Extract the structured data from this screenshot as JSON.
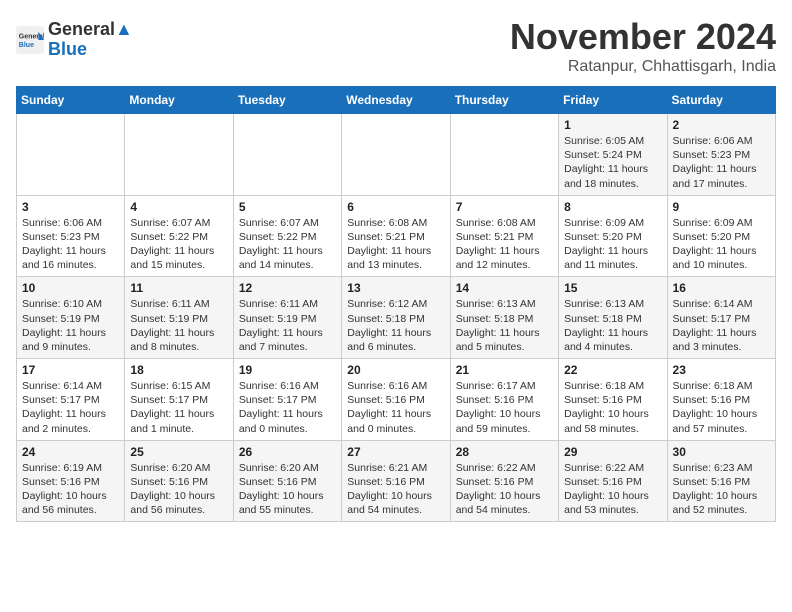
{
  "header": {
    "logo_line1": "General",
    "logo_line2": "Blue",
    "month": "November 2024",
    "location": "Ratanpur, Chhattisgarh, India"
  },
  "days_of_week": [
    "Sunday",
    "Monday",
    "Tuesday",
    "Wednesday",
    "Thursday",
    "Friday",
    "Saturday"
  ],
  "weeks": [
    [
      {
        "num": "",
        "info": ""
      },
      {
        "num": "",
        "info": ""
      },
      {
        "num": "",
        "info": ""
      },
      {
        "num": "",
        "info": ""
      },
      {
        "num": "",
        "info": ""
      },
      {
        "num": "1",
        "info": "Sunrise: 6:05 AM\nSunset: 5:24 PM\nDaylight: 11 hours and 18 minutes."
      },
      {
        "num": "2",
        "info": "Sunrise: 6:06 AM\nSunset: 5:23 PM\nDaylight: 11 hours and 17 minutes."
      }
    ],
    [
      {
        "num": "3",
        "info": "Sunrise: 6:06 AM\nSunset: 5:23 PM\nDaylight: 11 hours and 16 minutes."
      },
      {
        "num": "4",
        "info": "Sunrise: 6:07 AM\nSunset: 5:22 PM\nDaylight: 11 hours and 15 minutes."
      },
      {
        "num": "5",
        "info": "Sunrise: 6:07 AM\nSunset: 5:22 PM\nDaylight: 11 hours and 14 minutes."
      },
      {
        "num": "6",
        "info": "Sunrise: 6:08 AM\nSunset: 5:21 PM\nDaylight: 11 hours and 13 minutes."
      },
      {
        "num": "7",
        "info": "Sunrise: 6:08 AM\nSunset: 5:21 PM\nDaylight: 11 hours and 12 minutes."
      },
      {
        "num": "8",
        "info": "Sunrise: 6:09 AM\nSunset: 5:20 PM\nDaylight: 11 hours and 11 minutes."
      },
      {
        "num": "9",
        "info": "Sunrise: 6:09 AM\nSunset: 5:20 PM\nDaylight: 11 hours and 10 minutes."
      }
    ],
    [
      {
        "num": "10",
        "info": "Sunrise: 6:10 AM\nSunset: 5:19 PM\nDaylight: 11 hours and 9 minutes."
      },
      {
        "num": "11",
        "info": "Sunrise: 6:11 AM\nSunset: 5:19 PM\nDaylight: 11 hours and 8 minutes."
      },
      {
        "num": "12",
        "info": "Sunrise: 6:11 AM\nSunset: 5:19 PM\nDaylight: 11 hours and 7 minutes."
      },
      {
        "num": "13",
        "info": "Sunrise: 6:12 AM\nSunset: 5:18 PM\nDaylight: 11 hours and 6 minutes."
      },
      {
        "num": "14",
        "info": "Sunrise: 6:13 AM\nSunset: 5:18 PM\nDaylight: 11 hours and 5 minutes."
      },
      {
        "num": "15",
        "info": "Sunrise: 6:13 AM\nSunset: 5:18 PM\nDaylight: 11 hours and 4 minutes."
      },
      {
        "num": "16",
        "info": "Sunrise: 6:14 AM\nSunset: 5:17 PM\nDaylight: 11 hours and 3 minutes."
      }
    ],
    [
      {
        "num": "17",
        "info": "Sunrise: 6:14 AM\nSunset: 5:17 PM\nDaylight: 11 hours and 2 minutes."
      },
      {
        "num": "18",
        "info": "Sunrise: 6:15 AM\nSunset: 5:17 PM\nDaylight: 11 hours and 1 minute."
      },
      {
        "num": "19",
        "info": "Sunrise: 6:16 AM\nSunset: 5:17 PM\nDaylight: 11 hours and 0 minutes."
      },
      {
        "num": "20",
        "info": "Sunrise: 6:16 AM\nSunset: 5:16 PM\nDaylight: 11 hours and 0 minutes."
      },
      {
        "num": "21",
        "info": "Sunrise: 6:17 AM\nSunset: 5:16 PM\nDaylight: 10 hours and 59 minutes."
      },
      {
        "num": "22",
        "info": "Sunrise: 6:18 AM\nSunset: 5:16 PM\nDaylight: 10 hours and 58 minutes."
      },
      {
        "num": "23",
        "info": "Sunrise: 6:18 AM\nSunset: 5:16 PM\nDaylight: 10 hours and 57 minutes."
      }
    ],
    [
      {
        "num": "24",
        "info": "Sunrise: 6:19 AM\nSunset: 5:16 PM\nDaylight: 10 hours and 56 minutes."
      },
      {
        "num": "25",
        "info": "Sunrise: 6:20 AM\nSunset: 5:16 PM\nDaylight: 10 hours and 56 minutes."
      },
      {
        "num": "26",
        "info": "Sunrise: 6:20 AM\nSunset: 5:16 PM\nDaylight: 10 hours and 55 minutes."
      },
      {
        "num": "27",
        "info": "Sunrise: 6:21 AM\nSunset: 5:16 PM\nDaylight: 10 hours and 54 minutes."
      },
      {
        "num": "28",
        "info": "Sunrise: 6:22 AM\nSunset: 5:16 PM\nDaylight: 10 hours and 54 minutes."
      },
      {
        "num": "29",
        "info": "Sunrise: 6:22 AM\nSunset: 5:16 PM\nDaylight: 10 hours and 53 minutes."
      },
      {
        "num": "30",
        "info": "Sunrise: 6:23 AM\nSunset: 5:16 PM\nDaylight: 10 hours and 52 minutes."
      }
    ]
  ]
}
